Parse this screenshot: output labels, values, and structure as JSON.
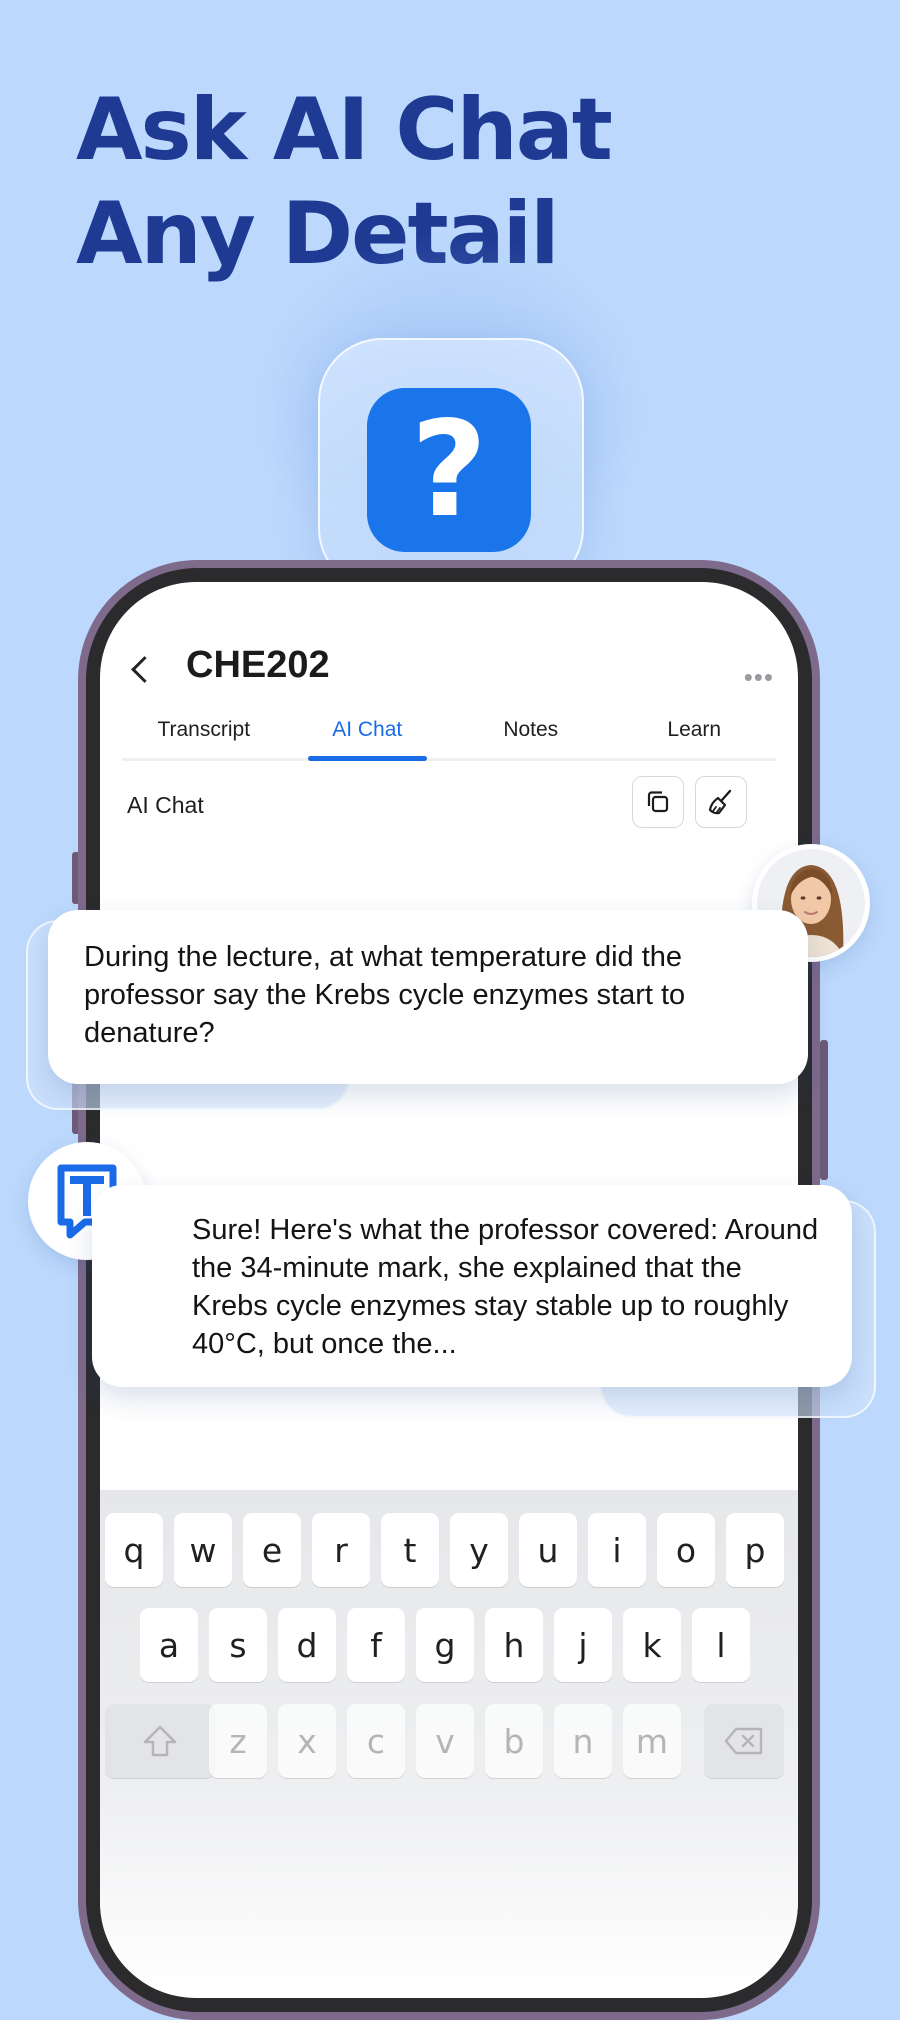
{
  "headline": {
    "line1": "Ask AI Chat",
    "line2": "Any Detail"
  },
  "promo_icon": {
    "name": "question-mark-icon",
    "glyph": "?",
    "color": "#1a74ea"
  },
  "header": {
    "title": "CHE202",
    "back_icon": "chevron-left-icon",
    "more_icon": "more-horizontal-icon"
  },
  "tabs": [
    {
      "label": "Transcript",
      "active": false
    },
    {
      "label": "AI Chat",
      "active": true
    },
    {
      "label": "Notes",
      "active": false
    },
    {
      "label": "Learn",
      "active": false
    }
  ],
  "section": {
    "label": "AI Chat",
    "copy_icon": "copy-icon",
    "clear_icon": "broom-icon"
  },
  "messages": [
    {
      "sender": "user",
      "text": "During the lecture, at what temperature did the professor say the Krebs cycle enzymes start to denature?"
    },
    {
      "sender": "assistant",
      "text": "Sure! Here's what the professor covered: Around the 34-minute mark, she explained that the Krebs cycle enzymes stay stable up to roughly 40°C,  but once the..."
    }
  ],
  "bot_logo": {
    "letter": "T",
    "color": "#1a6be8"
  },
  "keyboard": {
    "row1": [
      "q",
      "w",
      "e",
      "r",
      "t",
      "y",
      "u",
      "i",
      "o",
      "p"
    ],
    "row2": [
      "a",
      "s",
      "d",
      "f",
      "g",
      "h",
      "j",
      "k",
      "l"
    ],
    "row3": [
      "z",
      "x",
      "c",
      "v",
      "b",
      "n",
      "m"
    ],
    "shift_icon": "shift-icon",
    "delete_icon": "backspace-icon"
  },
  "colors": {
    "background": "#bcd8fc",
    "headline": "#1f3a93",
    "accent": "#1a6be8"
  }
}
